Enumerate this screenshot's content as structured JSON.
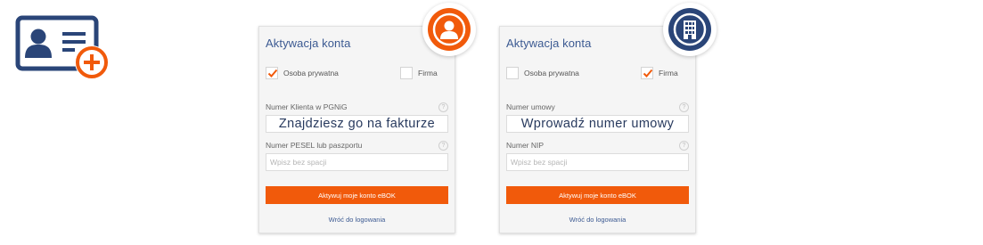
{
  "colors": {
    "navy": "#2a4578",
    "orange": "#f15a0b",
    "title_blue": "#3c5a92",
    "card_bg": "#f5f5f5"
  },
  "hero": {
    "icon": "id-card-add-icon"
  },
  "private_card": {
    "badge_icon": "person-icon",
    "title": "Aktywacja konta",
    "checkbox_private": {
      "label": "Osoba prywatna",
      "checked": true
    },
    "checkbox_company": {
      "label": "Firma",
      "checked": false
    },
    "field1": {
      "label": "Numer Klienta w PGNiG",
      "value": "Znajdziesz go na fakturze"
    },
    "field2": {
      "label": "Numer PESEL lub paszportu",
      "placeholder": "Wpisz bez spacji"
    },
    "submit_label": "Aktywuj moje konto eBOK",
    "back_link": "Wróć do logowania"
  },
  "company_card": {
    "badge_icon": "office-building-icon",
    "title": "Aktywacja konta",
    "checkbox_private": {
      "label": "Osoba prywatna",
      "checked": false
    },
    "checkbox_company": {
      "label": "Firma",
      "checked": true
    },
    "field1": {
      "label": "Numer umowy",
      "value": "Wprowadź numer umowy"
    },
    "field2": {
      "label": "Numer NIP",
      "placeholder": "Wpisz bez spacji"
    },
    "submit_label": "Aktywuj moje konto eBOK",
    "back_link": "Wróć do logowania"
  }
}
